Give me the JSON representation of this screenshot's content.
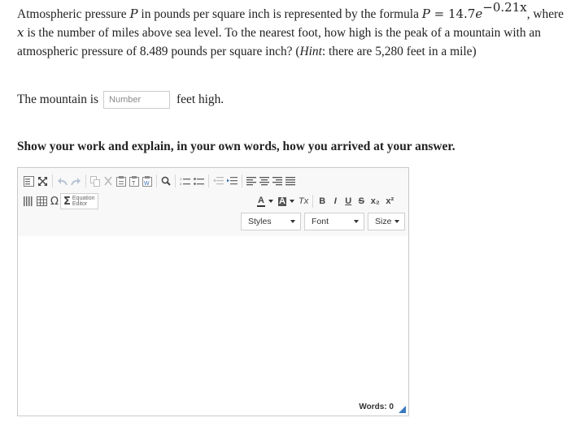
{
  "question": {
    "p1": "Atmospheric pressure ",
    "var_p": "P",
    "p2": " in pounds per square inch is represented by the formula ",
    "formula_lhs": "P",
    "formula_eq": " = 14.7",
    "formula_e": "e",
    "formula_exp": "−0.21x",
    "p3": ", where ",
    "var_x": "x",
    "p4": " is the number of miles above sea level. To the nearest foot, how high is the peak of a mountain with an atmospheric pressure of 8.489 pounds per square inch? (",
    "hint_label": "Hint",
    "p5": ": there are 5,280 feet in a mile)"
  },
  "answer": {
    "prefix": "The mountain is",
    "placeholder": "Number",
    "suffix": "feet high."
  },
  "instructions": "Show your work and explain, in your own words, how you arrived at your answer.",
  "editor": {
    "equation_label_1": "Equation",
    "equation_label_2": "Editor",
    "omega": "Ω",
    "sigma": "Σ",
    "format_buttons": {
      "text_color": "A",
      "bg_color": "A",
      "remove_format": "Tx",
      "bold": "B",
      "italic": "I",
      "underline": "U",
      "strike": "S",
      "subscript": "x₂",
      "superscript": "x²"
    },
    "styles_label": "Styles",
    "font_label": "Font",
    "size_label": "Size",
    "words_count": "Words: 0"
  },
  "colors": {
    "text": "#222222",
    "border": "#c9c9c9",
    "toolbar_bg": "#f8f8f8",
    "resize_handle": "#3a78c4"
  }
}
